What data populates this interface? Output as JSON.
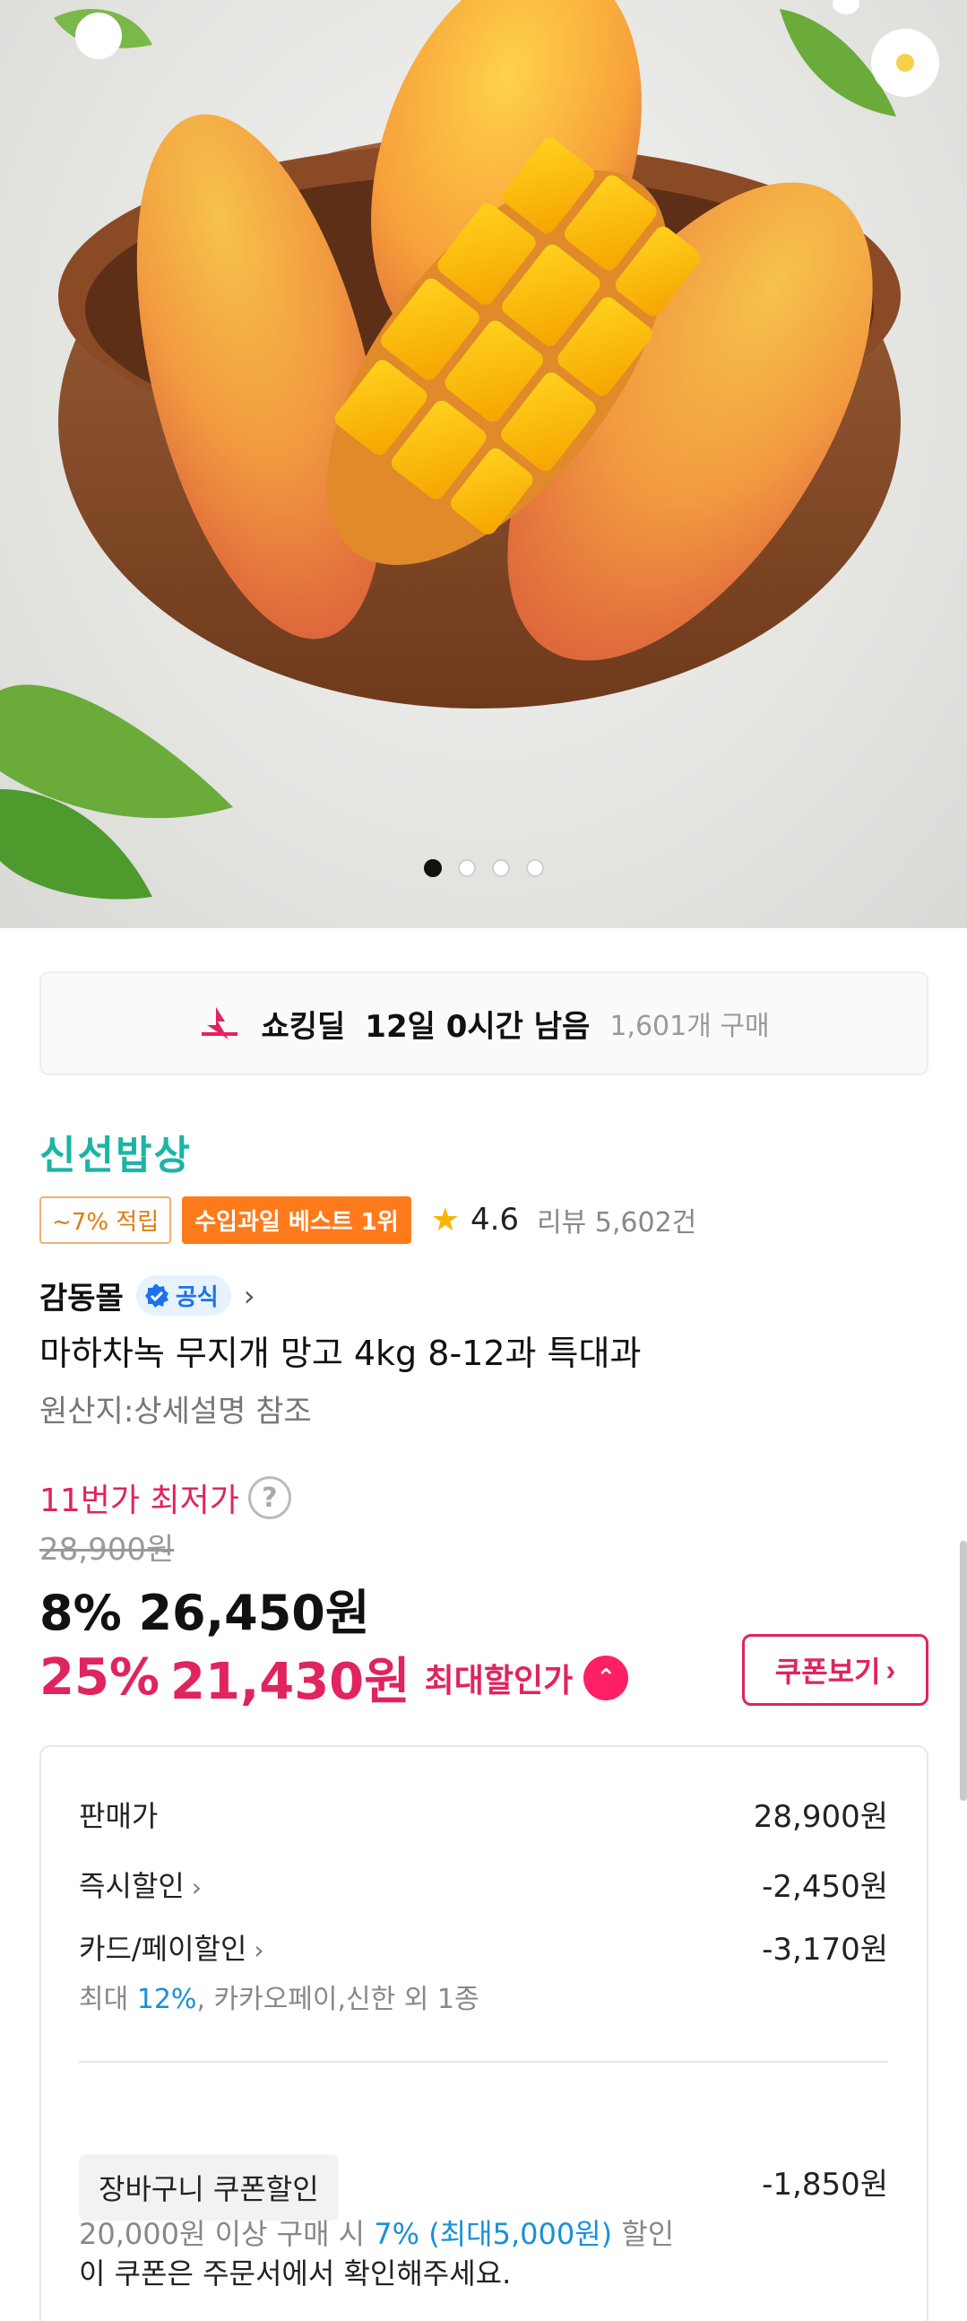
{
  "hero": {
    "image_alt": "",
    "slide_count": 4,
    "active_slide": 0
  },
  "deal": {
    "title": "쇼킹딜",
    "time_left": "12일 0시간 남음",
    "purchase_count": "1,601개 구매",
    "icon": "shocking-deal-icon"
  },
  "brand": "신선밥상",
  "tags": {
    "points": "~7% 적립",
    "best": "수입과일 베스트 1위",
    "rating": "4.6",
    "reviews": "리뷰 5,602건"
  },
  "seller": {
    "name": "감동몰",
    "official_label": "공식",
    "chevron": "›"
  },
  "product": {
    "title": "마하차녹 무지개 망고 4kg 8-12과 특대과",
    "origin": "원산지:상세설명 참조"
  },
  "price": {
    "lowest_label": "11번가 최저가",
    "help": "?",
    "original": "28,900원",
    "discounted": "8% 26,450원",
    "max_discount_pct": "25%",
    "max_price": "21,430원",
    "max_label": "최대할인가",
    "coupon_button": "쿠폰보기"
  },
  "breakdown": {
    "sale_label": "판매가",
    "sale_value": "28,900원",
    "instant_label": "즉시할인",
    "instant_value": "-2,450원",
    "card_label": "카드/페이할인",
    "card_value": "-3,170원",
    "card_note_prefix": "최대 ",
    "card_note_pct": "12%",
    "card_note_suffix": ", 카카오페이,신한 외 1종",
    "cart_coupon_label": "장바구니 쿠폰할인",
    "cart_coupon_value": "-1,850원",
    "cart_note_prefix": "20,000원 이상 구매 시 ",
    "cart_note_hl": "7% (최대5,000원)",
    "cart_note_suffix": " 할인",
    "cart_note_2": "이 쿠폰은 주문서에서 확인해주세요."
  },
  "colors": {
    "brand": "#1bb5a5",
    "accent": "#e0245e",
    "best_tag": "#ff7a1a",
    "star": "#f7b500",
    "link": "#1a8fd8"
  }
}
